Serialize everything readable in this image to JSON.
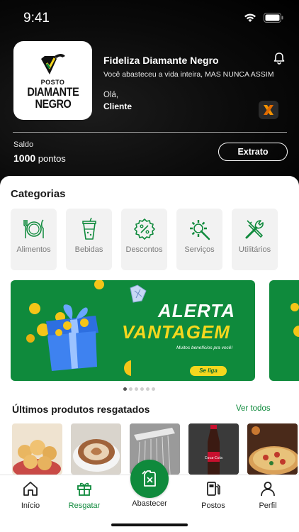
{
  "status_bar": {
    "time": "9:41"
  },
  "header": {
    "logo": {
      "small_text": "POSTO",
      "line1": "DIAMANTE",
      "line2": "NEGRO"
    },
    "title": "Fideliza Diamante Negro",
    "subtitle": "Você abasteceu a vida inteira, MAS NUNCA ASSIM",
    "greeting": "Olá,",
    "user_name": "Cliente",
    "saldo_label": "Saldo",
    "saldo_points": "1000",
    "saldo_unit": " pontos",
    "extrato_label": "Extrato"
  },
  "categories": {
    "title": "Categorias",
    "items": [
      {
        "label": "Alimentos",
        "icon": "cutlery-icon"
      },
      {
        "label": "Bebidas",
        "icon": "drink-cup-icon"
      },
      {
        "label": "Descontos",
        "icon": "discount-badge-icon"
      },
      {
        "label": "Serviços",
        "icon": "gear-wrench-icon"
      },
      {
        "label": "Utilitários",
        "icon": "tools-icon"
      }
    ]
  },
  "banner": {
    "title_line1": "ALERTA",
    "title_line2": "VANTAGEM",
    "tagline": "Muitos benefícios pra você!",
    "button_label": "Se liga",
    "total_slides": 6,
    "active_slide": 1
  },
  "recent": {
    "title": "Últimos produtos resgatados",
    "see_all": "Ver todos",
    "products": [
      {
        "name": "pão de queijo"
      },
      {
        "name": "cappuccino"
      },
      {
        "name": "chuveiro"
      },
      {
        "name": "coca-cola"
      },
      {
        "name": "pizza"
      }
    ]
  },
  "tabbar": {
    "items": [
      {
        "label": "Início",
        "icon": "home-icon"
      },
      {
        "label": "Resgatar",
        "icon": "gift-icon",
        "active": true
      },
      {
        "label": "Abastecer",
        "icon": "fuel-can-icon"
      },
      {
        "label": "Postos",
        "icon": "gas-pump-icon"
      },
      {
        "label": "Perfil",
        "icon": "user-icon"
      }
    ]
  },
  "colors": {
    "brand_green": "#0f8a3c",
    "banner_yellow": "#f5d71e",
    "header_bg": "#0a0a0a"
  }
}
